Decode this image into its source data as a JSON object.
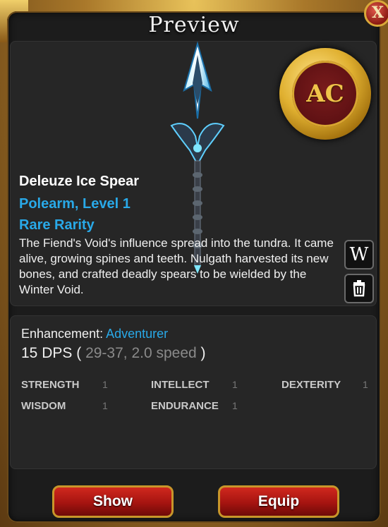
{
  "window": {
    "title": "Preview",
    "close_label": "X"
  },
  "item": {
    "name": "Deleuze Ice Spear",
    "type": "Polearm, Level 1",
    "rarity": "Rare Rarity",
    "description": "The Fiend's Void's influence spread into the tundra. It came alive, growing spines and teeth. Nulgath harvested its new bones, and crafted deadly spears to be wielded by the Winter Void.",
    "badge_text": "AC"
  },
  "side_buttons": {
    "wiki_label": "W"
  },
  "stats": {
    "enhancement_label": "Enhancement:",
    "enhancement_value": "Adventurer",
    "dps_value": "15 DPS",
    "dps_open": "(",
    "dps_detail": "29-37, 2.0 speed",
    "dps_close": ")",
    "attributes": [
      {
        "label": "STRENGTH",
        "value": "1"
      },
      {
        "label": "INTELLECT",
        "value": "1"
      },
      {
        "label": "DEXTERITY",
        "value": "1"
      },
      {
        "label": "WISDOM",
        "value": "1"
      },
      {
        "label": "ENDURANCE",
        "value": "1"
      }
    ]
  },
  "actions": {
    "show_label": "Show",
    "equip_label": "Equip"
  },
  "colors": {
    "accent": "#29a9e8",
    "button_red": "#a51410",
    "gold": "#c8962a"
  },
  "icons": [
    "close-icon",
    "ac-coin-icon",
    "wiki-icon",
    "trash-icon",
    "ice-spear-image"
  ]
}
